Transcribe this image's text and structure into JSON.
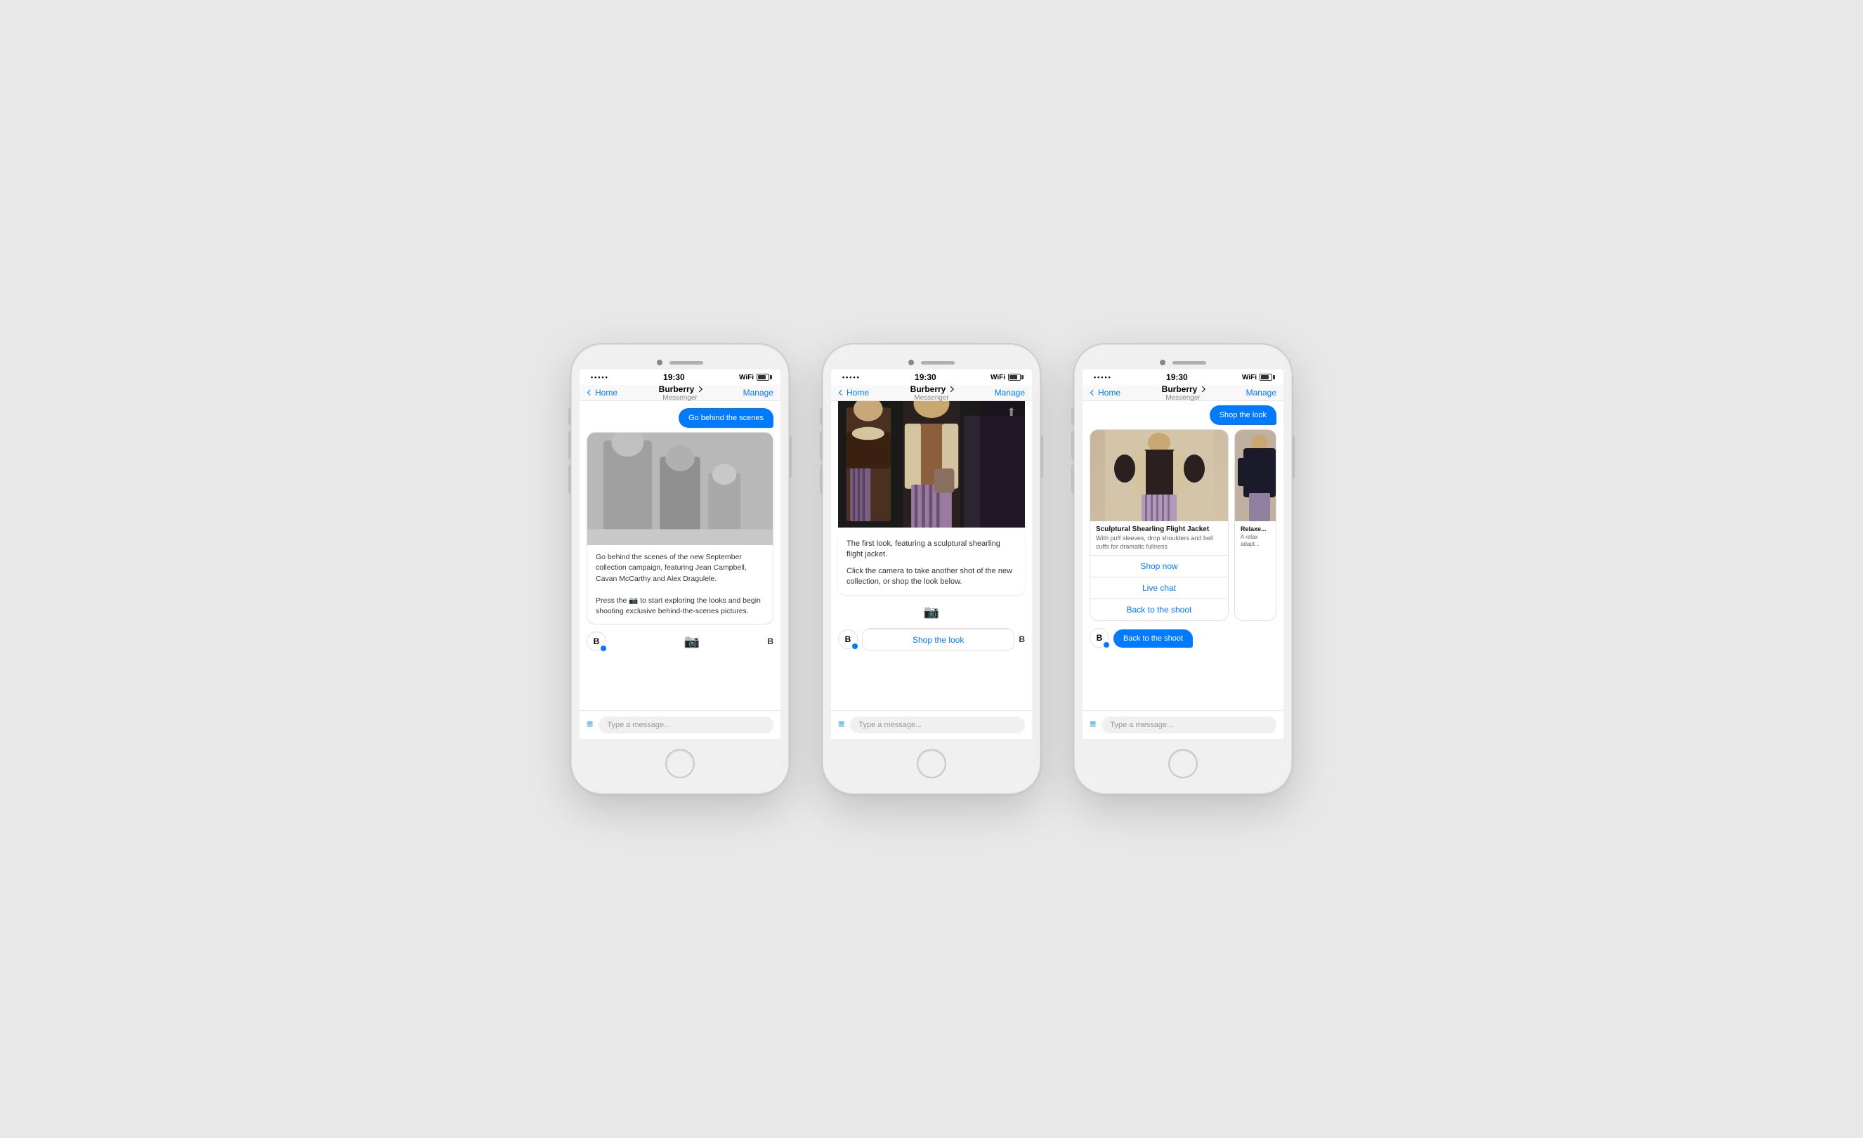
{
  "bg_color": "#e8e8e8",
  "phones": [
    {
      "id": "phone1",
      "status_bar": {
        "dots": "•••••",
        "time": "19:30",
        "battery": "▪"
      },
      "nav": {
        "back": "Home",
        "title": "Burberry",
        "title_arrow": ">",
        "subtitle": "Messenger",
        "action": "Manage"
      },
      "chat": {
        "user_bubble": "Go behind the scenes",
        "card_text": "Go behind the scenes of the new September collection campaign, featuring Jean Campbell, Cavan McCarthy and Alex Dragulele.\n\nPress the 📷 to start exploring the looks and begin shooting exclusive behind-the-scenes pictures.",
        "camera_emoji": "📷"
      },
      "input_placeholder": "Type a message..."
    },
    {
      "id": "phone2",
      "status_bar": {
        "dots": "•••••",
        "time": "19:30",
        "battery": "▪"
      },
      "nav": {
        "back": "Home",
        "title": "Burberry",
        "title_arrow": ">",
        "subtitle": "Messenger",
        "action": "Manage"
      },
      "chat": {
        "card_body_text1": "The first look, featuring a sculptural shearling flight jacket.",
        "card_body_text2": "Click the camera to take another shot of the new collection, or shop the look below.",
        "camera_emoji": "📷",
        "action_label": "Shop the look"
      },
      "input_placeholder": "Type a message..."
    },
    {
      "id": "phone3",
      "status_bar": {
        "dots": "•••••",
        "time": "19:30",
        "battery": "▪"
      },
      "nav": {
        "back": "Home",
        "title": "Burberry",
        "title_arrow": ">",
        "subtitle": "Messenger",
        "action": "Manage"
      },
      "chat": {
        "user_bubble": "Shop the look",
        "product1_title": "Sculptural Shearling Flight Jacket",
        "product1_desc": "With puff sleeves, drop shoulders and bell cuffs for dramatic fullness",
        "product2_title": "Relaxe...",
        "product2_desc": "A relax adapt...",
        "action_shop": "Shop now",
        "action_chat": "Live chat",
        "action_back_link": "Back to the shoot",
        "action_back_bubble": "Back to the shoot"
      },
      "input_placeholder": "Type a message..."
    }
  ]
}
